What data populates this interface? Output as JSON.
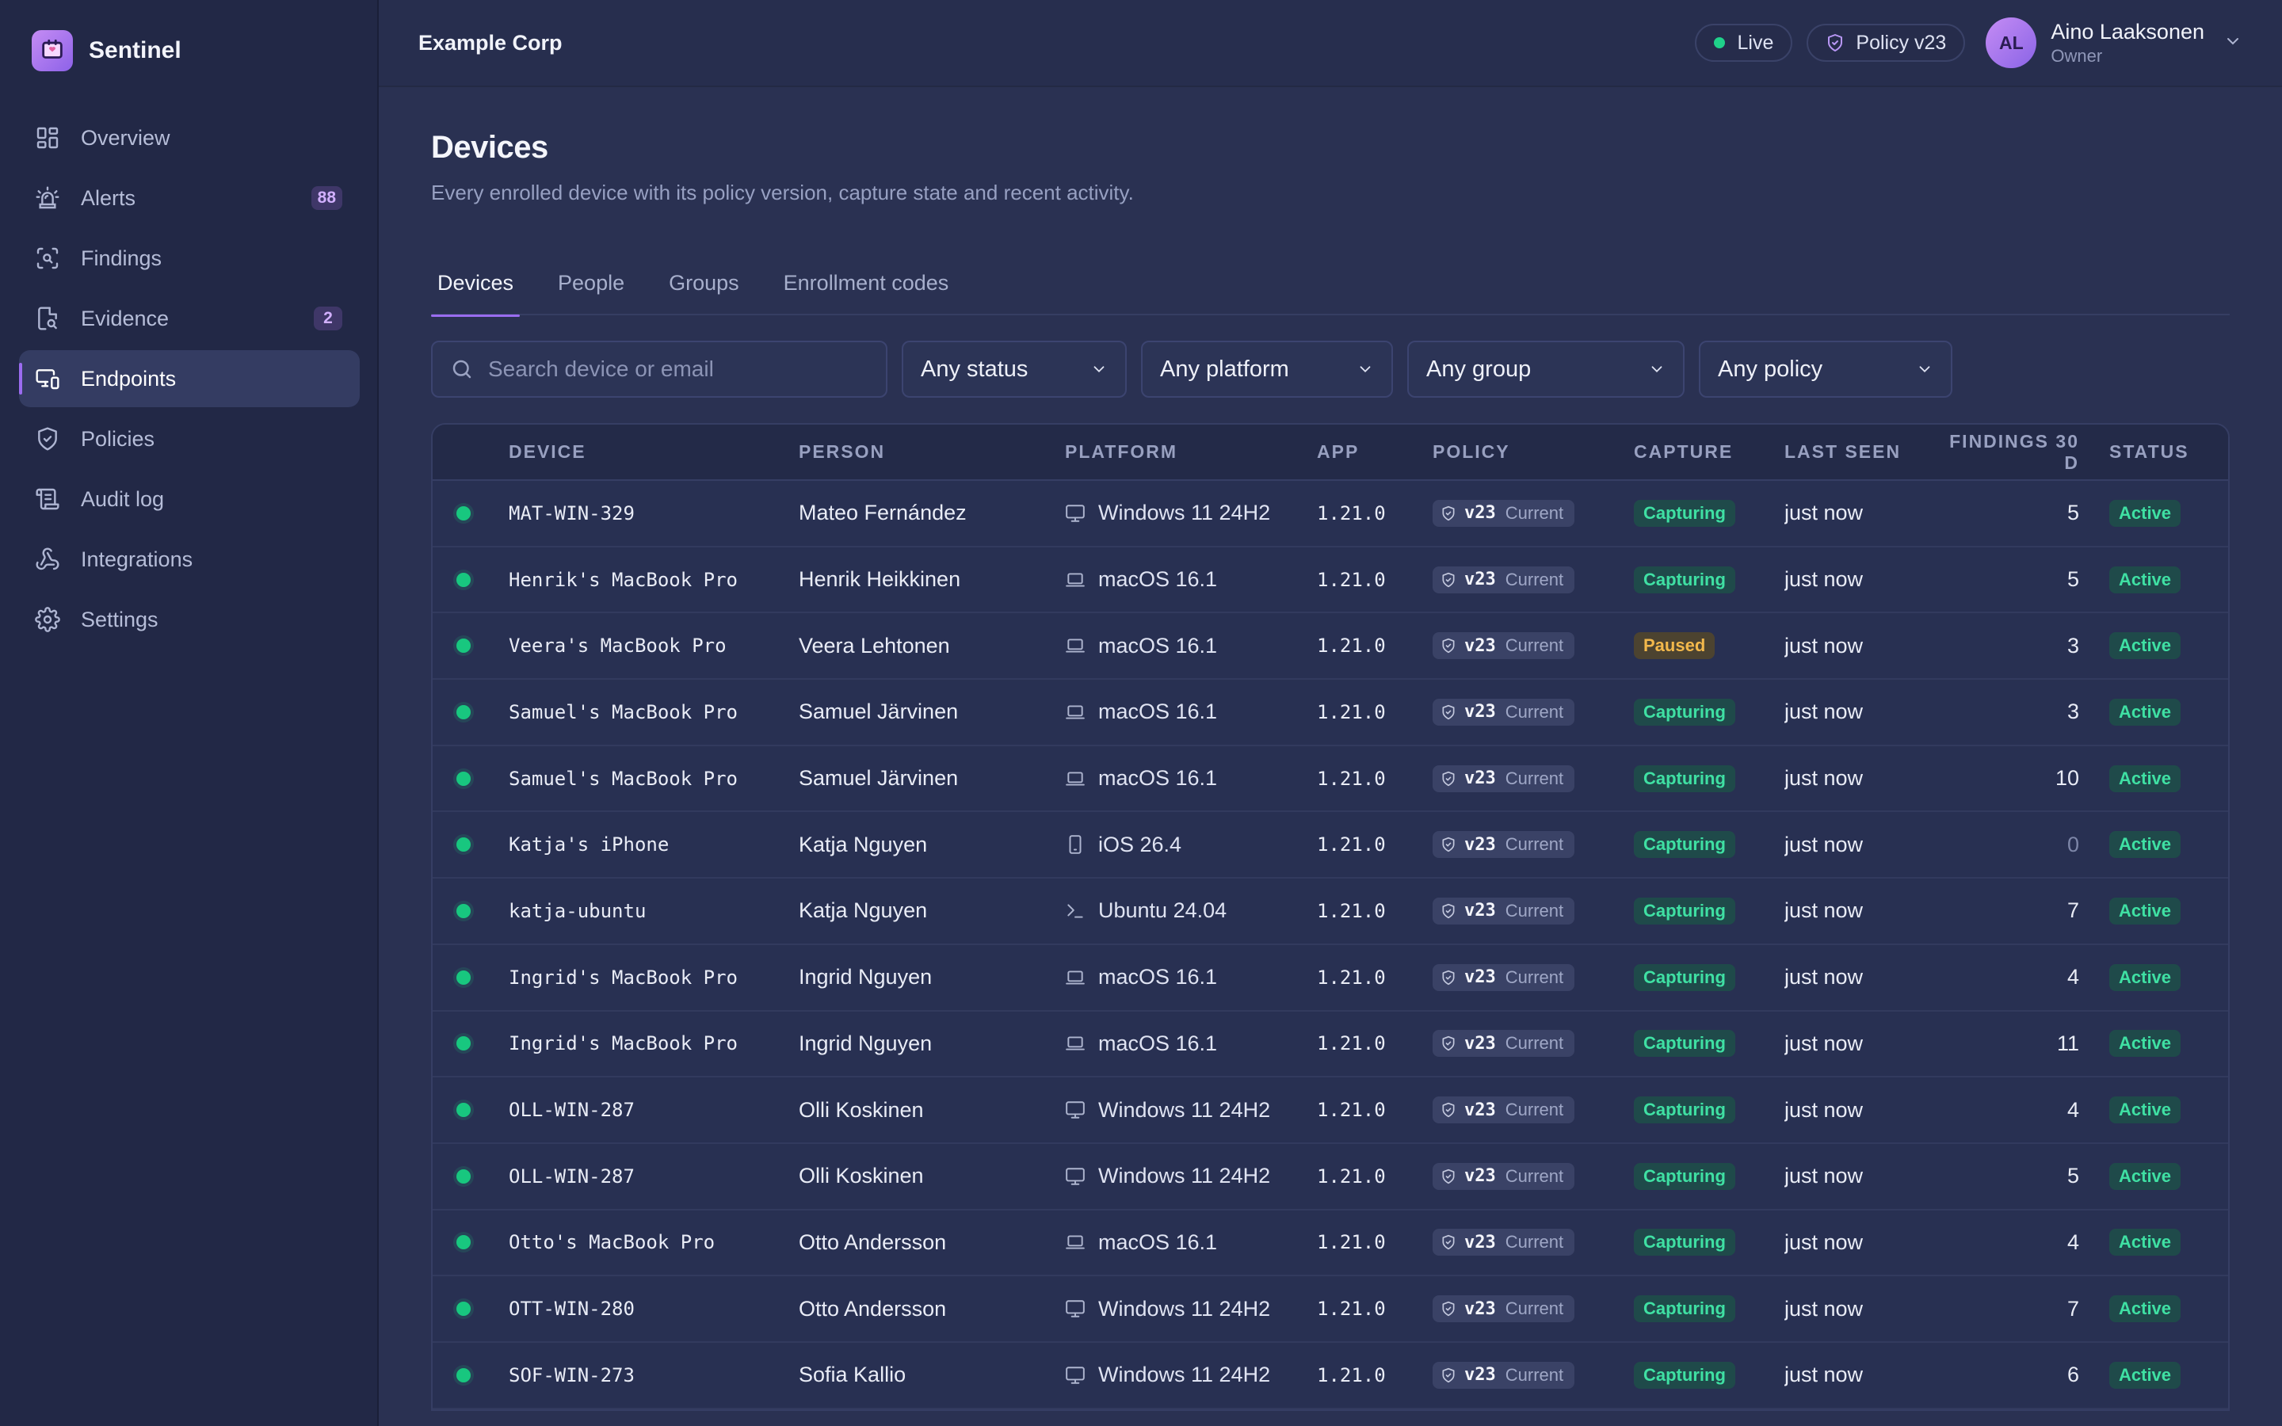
{
  "brand": {
    "name": "Sentinel"
  },
  "sidebar": {
    "items": [
      {
        "label": "Overview",
        "icon": "grid-icon"
      },
      {
        "label": "Alerts",
        "icon": "siren-icon",
        "badge": "88"
      },
      {
        "label": "Findings",
        "icon": "scan-search-icon"
      },
      {
        "label": "Evidence",
        "icon": "file-search-icon",
        "badge": "2"
      },
      {
        "label": "Endpoints",
        "icon": "monitor-smartphone-icon",
        "active": true
      },
      {
        "label": "Policies",
        "icon": "shield-check-icon"
      },
      {
        "label": "Audit log",
        "icon": "scroll-icon"
      },
      {
        "label": "Integrations",
        "icon": "webhook-icon"
      },
      {
        "label": "Settings",
        "icon": "gear-icon"
      }
    ]
  },
  "topbar": {
    "org": "Example Corp",
    "live_label": "Live",
    "policy_label": "Policy v23",
    "user": {
      "initials": "AL",
      "name": "Aino Laaksonen",
      "role": "Owner"
    }
  },
  "page": {
    "title": "Devices",
    "subtitle": "Every enrolled device with its policy version, capture state and recent activity."
  },
  "tabs": [
    {
      "label": "Devices",
      "active": true
    },
    {
      "label": "People"
    },
    {
      "label": "Groups"
    },
    {
      "label": "Enrollment codes"
    }
  ],
  "filters": {
    "search_placeholder": "Search device or email",
    "status": "Any status",
    "platform": "Any platform",
    "group": "Any group",
    "policy": "Any policy"
  },
  "table": {
    "columns": [
      "DEVICE",
      "PERSON",
      "PLATFORM",
      "APP",
      "POLICY",
      "CAPTURE",
      "LAST SEEN",
      "FINDINGS 30 D",
      "STATUS"
    ],
    "rows": [
      {
        "device": "MAT-WIN-329",
        "person": "Mateo Fernández",
        "platform": "Windows 11 24H2",
        "platform_icon": "monitor-icon",
        "app": "1.21.0",
        "policy": "v23",
        "policy_state": "Current",
        "capture": "Capturing",
        "last_seen": "just now",
        "findings": "5",
        "status": "Active"
      },
      {
        "device": "Henrik's MacBook Pro",
        "person": "Henrik Heikkinen",
        "platform": "macOS 16.1",
        "platform_icon": "laptop-icon",
        "app": "1.21.0",
        "policy": "v23",
        "policy_state": "Current",
        "capture": "Capturing",
        "last_seen": "just now",
        "findings": "5",
        "status": "Active"
      },
      {
        "device": "Veera's MacBook Pro",
        "person": "Veera Lehtonen",
        "platform": "macOS 16.1",
        "platform_icon": "laptop-icon",
        "app": "1.21.0",
        "policy": "v23",
        "policy_state": "Current",
        "capture": "Paused",
        "last_seen": "just now",
        "findings": "3",
        "status": "Active"
      },
      {
        "device": "Samuel's MacBook Pro",
        "person": "Samuel Järvinen",
        "platform": "macOS 16.1",
        "platform_icon": "laptop-icon",
        "app": "1.21.0",
        "policy": "v23",
        "policy_state": "Current",
        "capture": "Capturing",
        "last_seen": "just now",
        "findings": "3",
        "status": "Active"
      },
      {
        "device": "Samuel's MacBook Pro",
        "person": "Samuel Järvinen",
        "platform": "macOS 16.1",
        "platform_icon": "laptop-icon",
        "app": "1.21.0",
        "policy": "v23",
        "policy_state": "Current",
        "capture": "Capturing",
        "last_seen": "just now",
        "findings": "10",
        "status": "Active"
      },
      {
        "device": "Katja's iPhone",
        "person": "Katja Nguyen",
        "platform": "iOS 26.4",
        "platform_icon": "smartphone-icon",
        "app": "1.21.0",
        "policy": "v23",
        "policy_state": "Current",
        "capture": "Capturing",
        "last_seen": "just now",
        "findings": "0",
        "status": "Active"
      },
      {
        "device": "katja-ubuntu",
        "person": "Katja Nguyen",
        "platform": "Ubuntu 24.04",
        "platform_icon": "terminal-icon",
        "app": "1.21.0",
        "policy": "v23",
        "policy_state": "Current",
        "capture": "Capturing",
        "last_seen": "just now",
        "findings": "7",
        "status": "Active"
      },
      {
        "device": "Ingrid's MacBook Pro",
        "person": "Ingrid Nguyen",
        "platform": "macOS 16.1",
        "platform_icon": "laptop-icon",
        "app": "1.21.0",
        "policy": "v23",
        "policy_state": "Current",
        "capture": "Capturing",
        "last_seen": "just now",
        "findings": "4",
        "status": "Active"
      },
      {
        "device": "Ingrid's MacBook Pro",
        "person": "Ingrid Nguyen",
        "platform": "macOS 16.1",
        "platform_icon": "laptop-icon",
        "app": "1.21.0",
        "policy": "v23",
        "policy_state": "Current",
        "capture": "Capturing",
        "last_seen": "just now",
        "findings": "11",
        "status": "Active"
      },
      {
        "device": "OLL-WIN-287",
        "person": "Olli Koskinen",
        "platform": "Windows 11 24H2",
        "platform_icon": "monitor-icon",
        "app": "1.21.0",
        "policy": "v23",
        "policy_state": "Current",
        "capture": "Capturing",
        "last_seen": "just now",
        "findings": "4",
        "status": "Active"
      },
      {
        "device": "OLL-WIN-287",
        "person": "Olli Koskinen",
        "platform": "Windows 11 24H2",
        "platform_icon": "monitor-icon",
        "app": "1.21.0",
        "policy": "v23",
        "policy_state": "Current",
        "capture": "Capturing",
        "last_seen": "just now",
        "findings": "5",
        "status": "Active"
      },
      {
        "device": "Otto's MacBook Pro",
        "person": "Otto Andersson",
        "platform": "macOS 16.1",
        "platform_icon": "laptop-icon",
        "app": "1.21.0",
        "policy": "v23",
        "policy_state": "Current",
        "capture": "Capturing",
        "last_seen": "just now",
        "findings": "4",
        "status": "Active"
      },
      {
        "device": "OTT-WIN-280",
        "person": "Otto Andersson",
        "platform": "Windows 11 24H2",
        "platform_icon": "monitor-icon",
        "app": "1.21.0",
        "policy": "v23",
        "policy_state": "Current",
        "capture": "Capturing",
        "last_seen": "just now",
        "findings": "7",
        "status": "Active"
      },
      {
        "device": "SOF-WIN-273",
        "person": "Sofia Kallio",
        "platform": "Windows 11 24H2",
        "platform_icon": "monitor-icon",
        "app": "1.21.0",
        "policy": "v23",
        "policy_state": "Current",
        "capture": "Capturing",
        "last_seen": "just now",
        "findings": "6",
        "status": "Active"
      }
    ]
  },
  "colors": {
    "accent": "#9a6cf0",
    "online": "#18c77f",
    "capturing": "#3fe0a3",
    "paused": "#f2b84b"
  }
}
